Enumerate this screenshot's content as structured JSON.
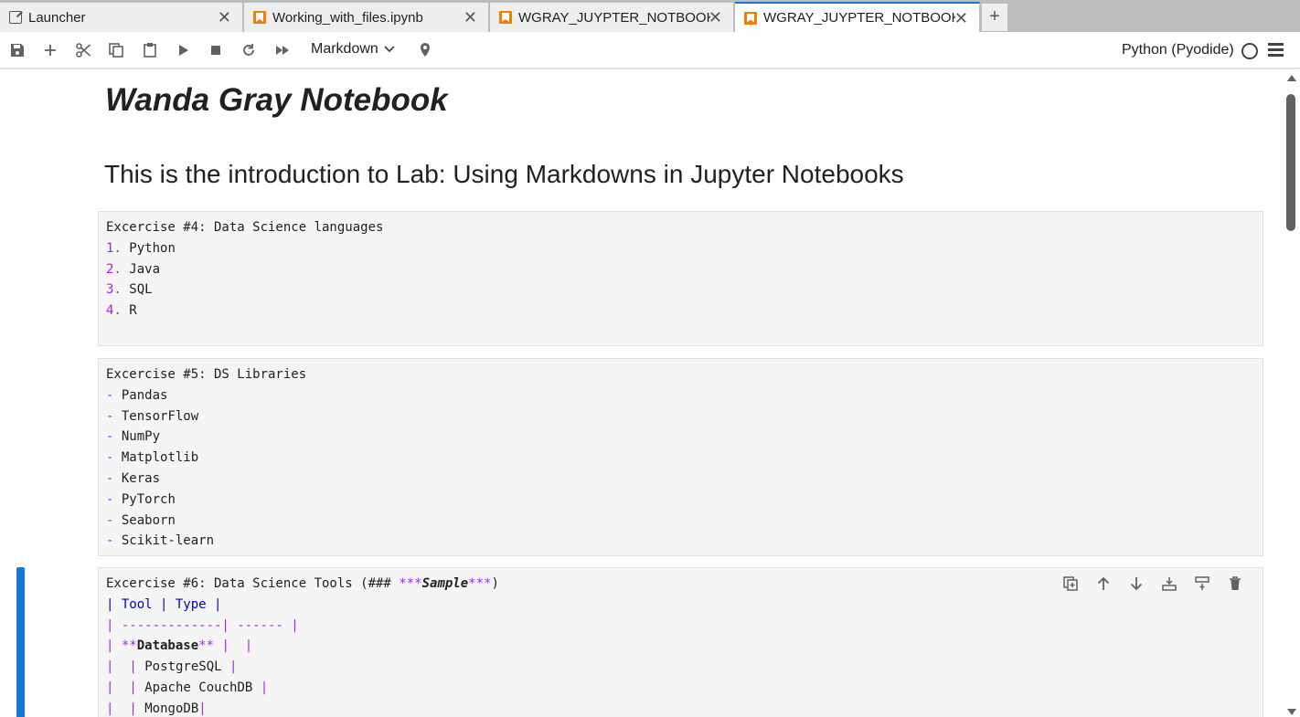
{
  "tabs": [
    {
      "label": "Launcher",
      "icon": "launcher-icon",
      "active": false
    },
    {
      "label": "Working_with_files.ipynb",
      "icon": "notebook-icon",
      "active": false
    },
    {
      "label": "WGRAY_JUYPTER_NOTBOOK",
      "icon": "notebook-icon",
      "active": false
    },
    {
      "label": "WGRAY_JUYPTER_NOTBOOK",
      "icon": "notebook-icon",
      "active": true
    }
  ],
  "tab_close_glyph": "✕",
  "add_tab_glyph": "+",
  "toolbar": {
    "cell_type": "Markdown",
    "kernel": "Python (Pyodide)"
  },
  "notebook": {
    "title": "Wanda Gray Notebook",
    "intro": "This is the introduction to Lab: Using Markdowns in Jupyter Notebooks",
    "cell4": {
      "heading": "Excercise #4: Data Science languages",
      "items": [
        {
          "num": "1.",
          "text": "Python"
        },
        {
          "num": "2.",
          "text": "Java"
        },
        {
          "num": "3.",
          "text": "SQL"
        },
        {
          "num": "4.",
          "text": "R"
        }
      ]
    },
    "cell5": {
      "heading": "Excercise #5: DS Libraries",
      "bullet": "-",
      "items": [
        "Pandas",
        "TensorFlow",
        "NumPy",
        "Matplotlib",
        "Keras",
        "PyTorch",
        "Seaborn",
        "Scikit-learn"
      ]
    },
    "cell6": {
      "heading_prefix": "Excercise #6: Data Science Tools (### ",
      "heading_stars_open": "***",
      "heading_emph": "Sample",
      "heading_stars_close": "***",
      "heading_suffix": ")",
      "table_header": "| Tool | Type |",
      "table_sep": "| -------------| ------ |",
      "row_db_pipe_open": "| ",
      "row_db_stars_open": "**",
      "row_db_text": "Database",
      "row_db_stars_close": "**",
      "row_db_pipe_close": " |  |",
      "rows": [
        "|  | PostgreSQL |",
        "|  | Apache CouchDB |",
        "|  | MongoDB|"
      ]
    }
  }
}
